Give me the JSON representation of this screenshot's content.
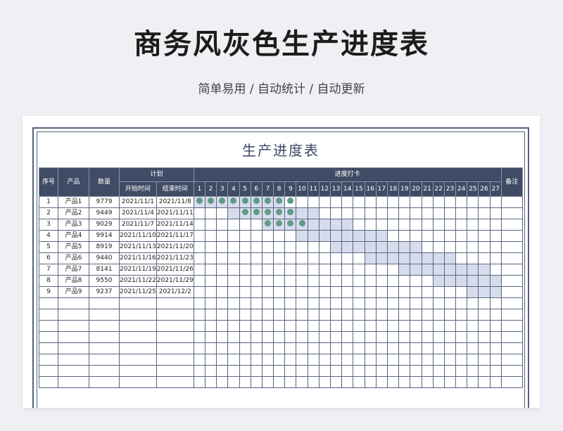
{
  "header": {
    "title": "商务风灰色生产进度表",
    "subtitle": "简单易用 / 自动统计 / 自动更新"
  },
  "sheet": {
    "title": "生产进度表",
    "columns": {
      "index": "序号",
      "product": "产品",
      "quantity": "数量",
      "plan": "计划",
      "start": "开始时间",
      "end": "结束时间",
      "progress": "进度打卡",
      "notes": "备注"
    },
    "days": [
      "1",
      "2",
      "3",
      "4",
      "5",
      "6",
      "7",
      "8",
      "9",
      "10",
      "11",
      "12",
      "13",
      "14",
      "15",
      "16",
      "17",
      "18",
      "19",
      "20",
      "21",
      "22",
      "23",
      "24",
      "25",
      "26",
      "27"
    ],
    "rows": [
      {
        "index": "1",
        "product": "产品1",
        "quantity": "9779",
        "start": "2021/11/1",
        "end": "2021/11/8",
        "bar_start": 1,
        "bar_end": 8,
        "checked": [
          1,
          2,
          3,
          4,
          5,
          6,
          7,
          8,
          9
        ]
      },
      {
        "index": "2",
        "product": "产品2",
        "quantity": "9449",
        "start": "2021/11/4",
        "end": "2021/11/11",
        "bar_start": 4,
        "bar_end": 11,
        "checked": [
          5,
          6,
          7,
          8,
          9
        ]
      },
      {
        "index": "3",
        "product": "产品3",
        "quantity": "9029",
        "start": "2021/11/7",
        "end": "2021/11/14",
        "bar_start": 7,
        "bar_end": 14,
        "checked": [
          7,
          8,
          9,
          10
        ]
      },
      {
        "index": "4",
        "product": "产品4",
        "quantity": "9914",
        "start": "2021/11/10",
        "end": "2021/11/17",
        "bar_start": 10,
        "bar_end": 17,
        "checked": []
      },
      {
        "index": "5",
        "product": "产品5",
        "quantity": "8919",
        "start": "2021/11/13",
        "end": "2021/11/20",
        "bar_start": 13,
        "bar_end": 20,
        "checked": []
      },
      {
        "index": "6",
        "product": "产品6",
        "quantity": "9440",
        "start": "2021/11/16",
        "end": "2021/11/23",
        "bar_start": 16,
        "bar_end": 23,
        "checked": []
      },
      {
        "index": "7",
        "product": "产品7",
        "quantity": "8141",
        "start": "2021/11/19",
        "end": "2021/11/26",
        "bar_start": 19,
        "bar_end": 26,
        "checked": []
      },
      {
        "index": "8",
        "product": "产品8",
        "quantity": "9550",
        "start": "2021/11/22",
        "end": "2021/11/29",
        "bar_start": 22,
        "bar_end": 27,
        "checked": []
      },
      {
        "index": "9",
        "product": "产品9",
        "quantity": "9237",
        "start": "2021/11/25",
        "end": "2021/12/2",
        "bar_start": 25,
        "bar_end": 27,
        "checked": []
      }
    ],
    "empty_rows": 8,
    "colors": {
      "header_bg": "#404c66",
      "bar": "#d7dcec",
      "dot": "#5e9c86"
    }
  }
}
